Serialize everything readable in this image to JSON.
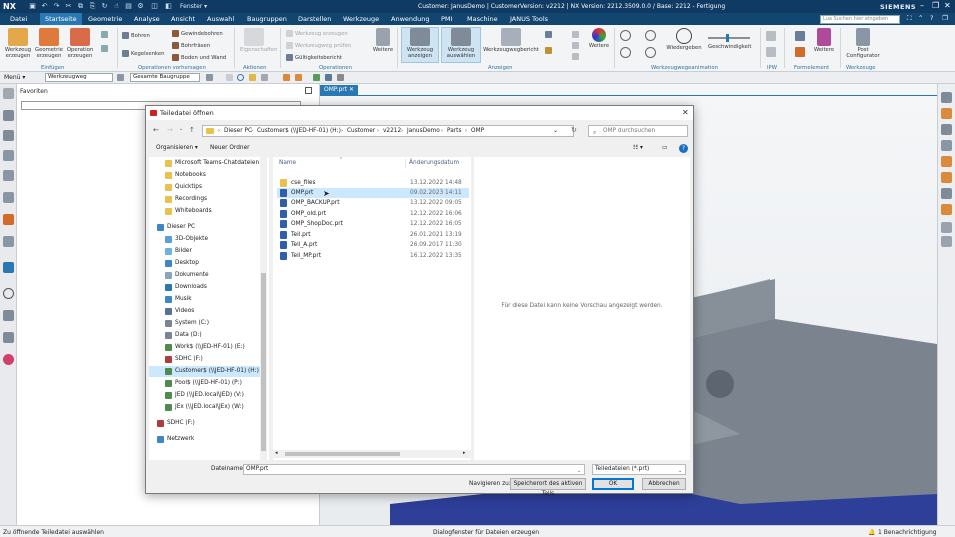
{
  "app": {
    "logo": "NX",
    "fenster": "Fenster ▾",
    "title": "Customer: JanusDemo | CustomerVersion: v2212 | NX Version: 2212.3509.0.0 / Base: 2212 - Fertigung",
    "brand": "SIEMENS",
    "command_search_placeholder": "Lua Suchen hier eingeben",
    "menu_tabs": [
      "Datei",
      "Startseite",
      "Geometrie",
      "Analyse",
      "Ansicht",
      "Auswahl",
      "Baugruppen",
      "Darstellen",
      "Werkzeuge",
      "Anwendung",
      "PMI",
      "Maschine",
      "JANUS Tools"
    ],
    "active_tab": "Startseite"
  },
  "ribbon": {
    "einfuegen": [
      "Werkzeug erzeugen",
      "Geometrie erzeugen",
      "Operation erzeugen"
    ],
    "bohren": "Bohren",
    "kegelsenken": "Kegelsenken",
    "gewindebohren": "Gewindebohren",
    "bohrfraesen": "Bohrfräsen",
    "boden_wand": "Boden und Wand",
    "eigenschaften": "Eigenschaften",
    "werkzeug_anzeigen": "Werkzeug anzeigen",
    "werkzeug_auswaehlen": "Werkzeug auswählen",
    "werkzeugwegbericht": "Werkzeugwegbericht",
    "weitere": "Weitere",
    "wiedergeben": "Wiedergeben",
    "geschwindigkeit": "Geschwindigkeit",
    "weitere2": "Weitere",
    "post_configurator": "Post Configurator",
    "nav_greyed": [
      "Werkzeug erzeugen",
      "Werkzeugweg prüfen"
    ],
    "gueltigkeitsbericht": "Gültigkeitsbericht",
    "weitere_op": "Weitere",
    "groups": [
      "Einfügen",
      "Operationen vorhersagen",
      "Aktionen",
      "Operationen",
      "Anzeigen",
      "Werkzeugwegeanimation",
      "IPW",
      "Formelement",
      "Werkzeuge"
    ]
  },
  "toolbar2": {
    "menu": "Menü ▾",
    "werkzeugweg": "Werkzeugweg",
    "baugruppe": "Gesamte Baugruppe"
  },
  "favorites": {
    "header": "Favoriten"
  },
  "viewport": {
    "tab": "OMP.prt"
  },
  "dialog": {
    "title": "Teiledatei öffnen",
    "breadcrumb": [
      "Dieser PC",
      "Customer$ (\\\\JED-HF-01) (H:)",
      "Customer",
      "v2212",
      "JanusDemo",
      "Parts",
      "OMP"
    ],
    "search_placeholder": "OMP durchsuchen",
    "organisieren": "Organisieren ▾",
    "neuer_ordner": "Neuer Ordner",
    "tree": [
      {
        "label": "Microsoft Teams-Chatdateien",
        "icon": "folder-icon"
      },
      {
        "label": "Notebooks",
        "icon": "folder-icon"
      },
      {
        "label": "Quicktips",
        "icon": "folder-icon"
      },
      {
        "label": "Recordings",
        "icon": "folder-icon"
      },
      {
        "label": "Whiteboards",
        "icon": "folder-icon"
      },
      {
        "label": "Dieser PC",
        "icon": "pc-icon"
      },
      {
        "label": "3D-Objekte",
        "icon": "cube-icon"
      },
      {
        "label": "Bilder",
        "icon": "image-icon"
      },
      {
        "label": "Desktop",
        "icon": "desktop-icon"
      },
      {
        "label": "Dokumente",
        "icon": "document-icon"
      },
      {
        "label": "Downloads",
        "icon": "download-icon"
      },
      {
        "label": "Musik",
        "icon": "music-icon"
      },
      {
        "label": "Videos",
        "icon": "video-icon"
      },
      {
        "label": "System (C:)",
        "icon": "drive-icon"
      },
      {
        "label": "Data (D:)",
        "icon": "drive-icon"
      },
      {
        "label": "Work$ (\\\\JED-HF-01) (E:)",
        "icon": "network-drive-icon"
      },
      {
        "label": "SDHC (F:)",
        "icon": "sd-icon"
      },
      {
        "label": "Customer$ (\\\\JED-HF-01) (H:)",
        "icon": "network-drive-icon"
      },
      {
        "label": "Pool$ (\\\\JED-HF-01) (P:)",
        "icon": "network-drive-icon"
      },
      {
        "label": "JED (\\\\JED.local\\JED) (V:)",
        "icon": "network-drive-icon"
      },
      {
        "label": "JEx (\\\\JED.local\\JEx) (W:)",
        "icon": "network-drive-icon"
      },
      {
        "label": "SDHC (F:)",
        "icon": "sd-icon"
      },
      {
        "label": "Netzwerk",
        "icon": "network-icon"
      }
    ],
    "columns": {
      "name": "Name",
      "date": "Änderungsdatum"
    },
    "files": [
      {
        "name": "cse_files",
        "date": "13.12.2022 14:48",
        "type": "folder"
      },
      {
        "name": "OMP.prt",
        "date": "09.02.2023 14:11",
        "type": "prt"
      },
      {
        "name": "OMP_BACKUP.prt",
        "date": "13.12.2022 09:05",
        "type": "prt"
      },
      {
        "name": "OMP_old.prt",
        "date": "12.12.2022 16:06",
        "type": "prt"
      },
      {
        "name": "OMP_ShopDoc.prt",
        "date": "12.12.2022 16:05",
        "type": "prt"
      },
      {
        "name": "Teil.prt",
        "date": "26.01.2021 13:19",
        "type": "prt"
      },
      {
        "name": "Teil_A.prt",
        "date": "26.09.2017 11:30",
        "type": "prt"
      },
      {
        "name": "Teil_MP.prt",
        "date": "16.12.2022 13:35",
        "type": "prt"
      }
    ],
    "preview_message": "Für diese Datei kann keine Vorschau angezeigt werden.",
    "filename_label": "Dateiname:",
    "filename_value": "OMP.prt",
    "filetype": "Teiledateien (*.prt)",
    "navigate_label": "Navigieren zu:",
    "nav_active_button": "Speicherort des aktiven Teils",
    "ok": "OK",
    "cancel": "Abbrechen"
  },
  "status": {
    "left": "Zu öffnende Teiledatei auswählen",
    "center": "Dialogfenster für Dateien erzeugen",
    "right": "1 Benachrichtigung"
  },
  "colors": {
    "titlebar": "#0f3a63",
    "menubar": "#12456f",
    "accent": "#2a78b3",
    "selection": "#cce8ff"
  }
}
